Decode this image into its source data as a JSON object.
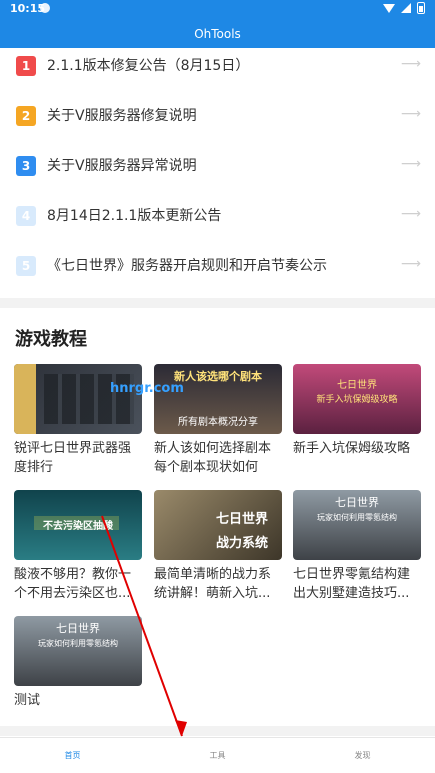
{
  "status_bar": {
    "time": "10:15"
  },
  "app": {
    "title": "OhTools"
  },
  "notices": [
    {
      "num": "1",
      "color": "#F04B4B",
      "label": "2.1.1版本修复公告（8月15日）",
      "faded": false
    },
    {
      "num": "2",
      "color": "#F5A623",
      "label": "关于V服服务器修复说明",
      "faded": false
    },
    {
      "num": "3",
      "color": "#2F8DF0",
      "label": "关于V服服务器异常说明",
      "faded": false
    },
    {
      "num": "4",
      "color": "#2F8DF0",
      "label": "8月14日2.1.1版本更新公告",
      "faded": true
    },
    {
      "num": "5",
      "color": "#2F8DF0",
      "label": "《七日世界》服务器开启规则和开启节奏公示",
      "faded": true
    }
  ],
  "section": {
    "title": "游戏教程"
  },
  "tutorials": [
    {
      "caption": "锐评七日世界武器强度排行",
      "thumb_text": "",
      "thumb_bg": "#3b4048"
    },
    {
      "caption": "新人该如何选择剧本每个剧本现状如何",
      "thumb_text": "新人该选哪个剧本",
      "thumb_sub": "所有剧本概况分享",
      "thumb_bg": "#4a4a56"
    },
    {
      "caption": "新手入坑保姆级攻略",
      "thumb_text": "七日世界",
      "thumb_sub": "新手入坑保姆级攻略",
      "thumb_bg": "#9b3b6e"
    },
    {
      "caption": "酸液不够用？教你一个不用去污染区也...",
      "thumb_text": "不去污染区抽酸",
      "thumb_bg": "#1f5f6a"
    },
    {
      "caption": "最简单清晰的战力系统讲解！萌新入坑...",
      "thumb_text": "七日世界",
      "thumb_sub": "战力系统",
      "thumb_bg": "#7a6a50"
    },
    {
      "caption": "七日世界零氪结构建出大别墅建造技巧...",
      "thumb_text": "七日世界",
      "thumb_sub": "玩家如何利用零氪结构",
      "thumb_bg": "#5a5d62"
    },
    {
      "caption": "测试",
      "thumb_text": "七日世界",
      "thumb_sub": "玩家如何利用零氪结构",
      "thumb_bg": "#5a5d62"
    }
  ],
  "watermark": "hnrgr.com",
  "bottom_nav": [
    {
      "label": "首页",
      "active": true
    },
    {
      "label": "工具",
      "active": false
    },
    {
      "label": "发现",
      "active": false
    }
  ]
}
